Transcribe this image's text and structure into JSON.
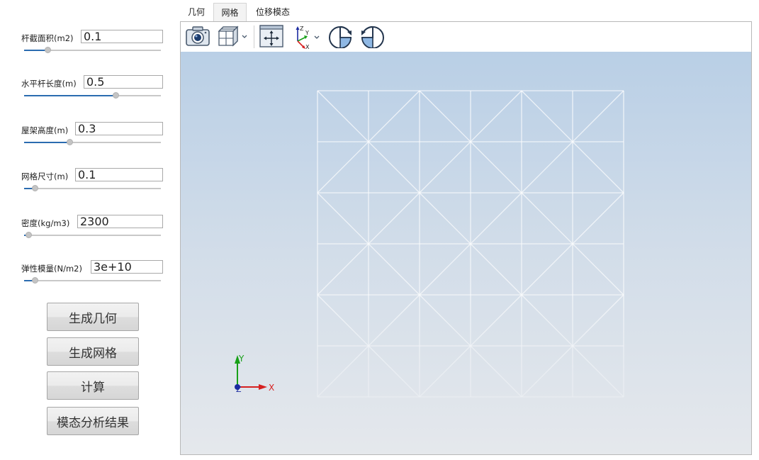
{
  "params": [
    {
      "label": "杆截面积(m2)",
      "value": "0.1",
      "slider": 0.17
    },
    {
      "label": "水平杆长度(m)",
      "value": "0.5",
      "slider": 0.67
    },
    {
      "label": "屋架高度(m)",
      "value": "0.3",
      "slider": 0.33
    },
    {
      "label": "网格尺寸(m)",
      "value": "0.1",
      "slider": 0.08
    },
    {
      "label": "密度(kg/m3)",
      "value": "2300",
      "slider": 0.03
    },
    {
      "label": "弹性模量(N/m2)",
      "value": "3e+10",
      "slider": 0.08
    }
  ],
  "buttons": {
    "generate_geometry": "生成几何",
    "generate_mesh": "生成网格",
    "compute": "计算",
    "modal_results": "模态分析结果"
  },
  "tabs": {
    "geometry": "几何",
    "mesh": "网格",
    "displacement_mode": "位移模态",
    "active": "网格"
  },
  "toolbar": {
    "icons": [
      "camera-icon",
      "cube-view-icon",
      "fit-view-icon",
      "axes-orientation-icon",
      "rotate-clockwise-icon",
      "rotate-counterclockwise-icon"
    ],
    "axes_icon_labels": {
      "z": "Z",
      "y": "Y",
      "x": "X"
    }
  },
  "triad": {
    "x": "X",
    "y": "Y",
    "z": "Z",
    "x_color": "#d62020",
    "y_color": "#18a018",
    "z_color": "#1a2aa0"
  },
  "colors": {
    "accent": "#2b6cb0",
    "mesh_line": "#ffffff",
    "bg_top": "#b9cfe6",
    "bg_bottom": "#e5e8ec"
  }
}
